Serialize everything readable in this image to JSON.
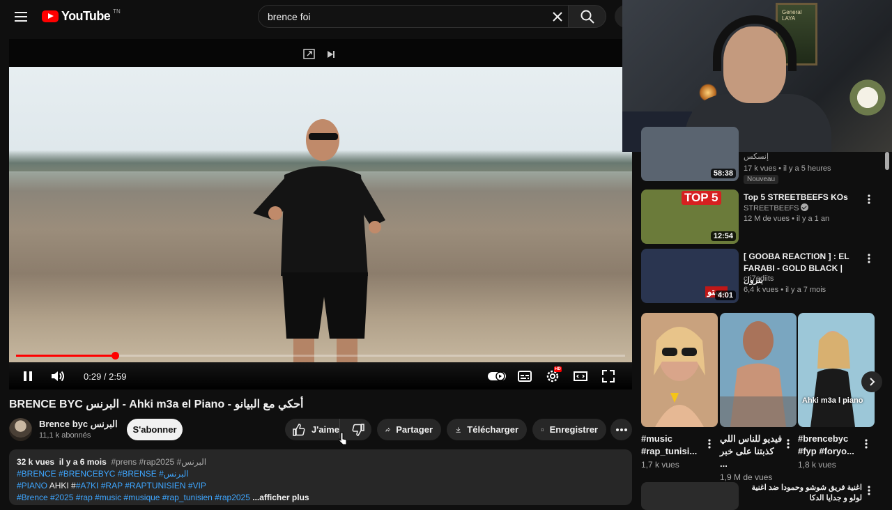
{
  "header": {
    "logo_text": "YouTube",
    "logo_country": "TN",
    "search_value": "brence foi"
  },
  "player": {
    "time_current": "0:29",
    "time_separator": " / ",
    "time_total": "2:59",
    "progress_fraction": 0.162,
    "settings_badge": "HD"
  },
  "video": {
    "title": "BRENCE BYC البرنس - Ahki m3a el Piano - أحكي مع البيانو",
    "channel_name": "Brence  byc البرنس",
    "subscribers": "11,1 k abonnés",
    "subscribe_label": "S'abonner",
    "like_label": "J'aime",
    "share_label": "Partager",
    "download_label": "Télécharger",
    "save_label": "Enregistrer"
  },
  "description": {
    "views": "32 k vues",
    "age": "il y a 6 mois",
    "inline_tags": "#prens #rap2025 #البرنس",
    "line2": "#BRENCE #BRENCEBYC #BRENSE #البرنس",
    "line3_a": "#PIANO",
    "line3_b": " AHKI #",
    "line3_c": "#A7KI #RAP #RAPTUNISIEN #VIP",
    "line4": "#Brence #2025  #rap  #music  #musique #rap_tunisien #rap2025",
    "more_label": " ...afficher plus"
  },
  "webcam": {
    "frame_label": "General LAYA"
  },
  "recommendations": [
    {
      "title": "",
      "channel": "إنسكس",
      "meta": "17 k vues • il y a 5 heures",
      "badge": "Nouveau",
      "duration": "58:38",
      "thumb_color": "#5a6470"
    },
    {
      "title": "Top 5 STREETBEEFS KOs",
      "channel": "STREETBEEFS",
      "meta": "12 M de vues • il y a 1 an",
      "duration": "12:54",
      "thumb_text": "TOP 5",
      "thumb_color": "#6b7b3a"
    },
    {
      "title": "[ GOOBA REACTION ] : EL FARABI - GOLD BLACK | بترول",
      "channel": "cri7ediits",
      "meta": "6,4 k vues • il y a 7 mois",
      "duration": "4:01",
      "thumb_text": "يستو",
      "thumb_color": "#2a3550"
    }
  ],
  "shorts": [
    {
      "title": "#music #rap_tunisi...",
      "views": "1,7 k vues",
      "overlay": "",
      "thumb_color": "#c9a27e"
    },
    {
      "title": "فيديو للناس اللي كذبتنا على خبر ...",
      "views": "1,9 M de vues",
      "overlay": "",
      "thumb_color": "#7aa6c0"
    },
    {
      "title": "#brencebyc #fyp #foryo...",
      "views": "1,8 k vues",
      "overlay": "Ahki m3a l piano",
      "thumb_color": "#9cc7d8"
    }
  ],
  "last_recommendation": {
    "title": "اغنية فريق شوشو وحمودا ضد اغنية لولو و جدايا الدكا"
  },
  "colors": {
    "accent": "#ff0000",
    "link": "#3ea6ff",
    "background": "#0f0f0f"
  }
}
